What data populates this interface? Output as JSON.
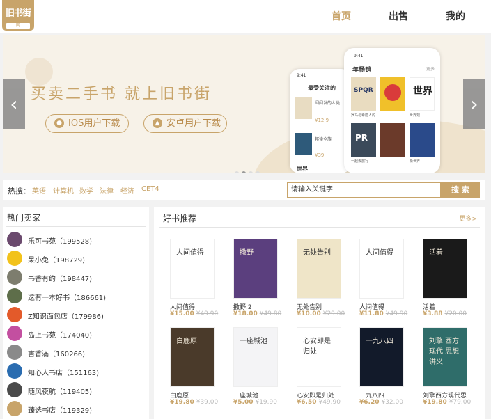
{
  "brand": {
    "logo_text": "旧书街",
    "logo_sub": "网"
  },
  "nav": [
    {
      "label": "首页"
    },
    {
      "label": "出售"
    },
    {
      "label": "我的"
    }
  ],
  "banner": {
    "slogan": "买卖二手书  就上旧书街",
    "ios_label": "IOS用户下载",
    "android_label": "安卓用户下载",
    "phone_front_time": "9:41",
    "phone_front_title": "年畅销",
    "phone_front_more": "更多",
    "phone_back_title": "最受关注的",
    "phone_back_line1": "闷闷发的人类",
    "phone_back_price1": "¥12.9",
    "phone_back_line2": "邦读全族",
    "phone_back_price2": "¥39",
    "phone_back_bottom": "世界",
    "mini_book_1": "罗马与希腊人的",
    "mini_book_2": "一起去旅行",
    "mini_book_3": "世界观",
    "mini_book_4": "新世界",
    "prev_arrow": "‹",
    "next_arrow": "›"
  },
  "search": {
    "hot_label": "热搜：",
    "keywords": [
      "英语",
      "计算机",
      "数学",
      "法律",
      "经济",
      "CET4"
    ],
    "placeholder": "请输入关键字",
    "button": "搜 索"
  },
  "sellers": {
    "title": "热门卖家",
    "items": [
      {
        "name": "乐可书苑（199528)",
        "color": "#6b4a6e"
      },
      {
        "name": "呆小兔（198729)",
        "color": "#f2c21b"
      },
      {
        "name": "书香有约（198447)",
        "color": "#7d7d6e"
      },
      {
        "name": "这有一本好书（186661)",
        "color": "#5e6e4a"
      },
      {
        "name": "Z知识面包店（179986)",
        "color": "#e35a2a"
      },
      {
        "name": "岛上书苑（174040)",
        "color": "#c34fa0"
      },
      {
        "name": "書香滿（160266)",
        "color": "#8a8a8a"
      },
      {
        "name": "知心人书店（151163)",
        "color": "#2a6cb0"
      },
      {
        "name": "随风夜航（119405)",
        "color": "#4a4a4a"
      },
      {
        "name": "臻选书店（119329)",
        "color": "#c8a46a"
      }
    ]
  },
  "books": {
    "title": "好书推荐",
    "more": "更多>",
    "items": [
      {
        "title": "人间值得",
        "price": "¥15.00",
        "orig": "¥49.90",
        "bg": "#ffffff",
        "cover_text": "人间值得"
      },
      {
        "title": "撒野.2",
        "price": "¥18.00",
        "orig": "¥49.80",
        "bg": "#5b3f7e",
        "cover_text": "撒野"
      },
      {
        "title": "无处告别",
        "price": "¥10.00",
        "orig": "¥29.00",
        "bg": "#efe5c8",
        "cover_text": "无处告别"
      },
      {
        "title": "人间值得",
        "price": "¥11.80",
        "orig": "¥49.90",
        "bg": "#ffffff",
        "cover_text": "人间值得"
      },
      {
        "title": "活着",
        "price": "¥3.88",
        "orig": "¥20.00",
        "bg": "#1a1a1a",
        "cover_text": "活着"
      },
      {
        "title": "白鹿原",
        "price": "¥19.80",
        "orig": "¥39.00",
        "bg": "#4a3a2a",
        "cover_text": "白鹿原"
      },
      {
        "title": "一座城池",
        "price": "¥5.00",
        "orig": "¥19.90",
        "bg": "#f4f4f6",
        "cover_text": "一座城池"
      },
      {
        "title": "心安即是归处",
        "price": "¥6.50",
        "orig": "¥49.90",
        "bg": "#ffffff",
        "cover_text": "心安即是归处"
      },
      {
        "title": "一九八四",
        "price": "¥6.20",
        "orig": "¥32.00",
        "bg": "#121a2a",
        "cover_text": "一九八四"
      },
      {
        "title": "刘擎西方现代思",
        "price": "¥19.80",
        "orig": "¥79.00",
        "bg": "#2f6d6a",
        "cover_text": "刘擎 西方现代 思想讲义"
      }
    ]
  },
  "colors": {
    "accent": "#c8a46a"
  }
}
